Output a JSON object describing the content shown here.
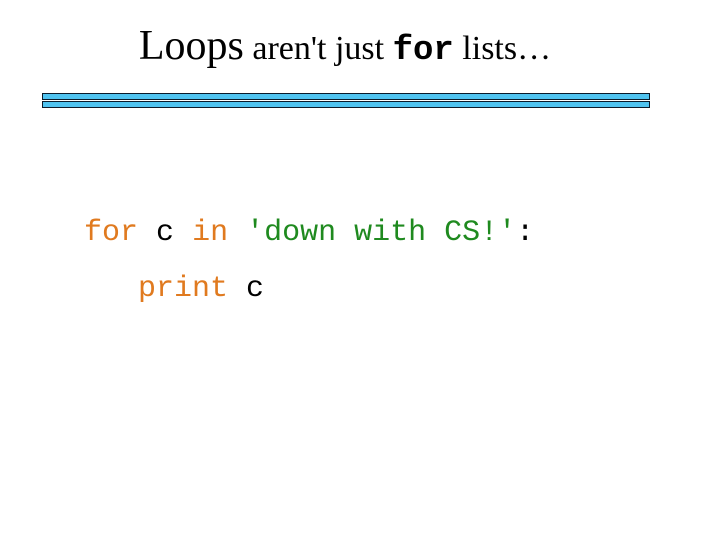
{
  "slide": {
    "title": {
      "part1": "Loops",
      "part2": " aren't just ",
      "code": "for",
      "part3": " lists…"
    },
    "code": {
      "line1": {
        "kw_for": "for",
        "sp1": " ",
        "var": "c",
        "sp2": " ",
        "kw_in": "in",
        "sp3": " ",
        "string": "'down with CS!'",
        "colon": ":"
      },
      "line2": {
        "indent": "   ",
        "kw_print": "print",
        "sp": " ",
        "var": "c"
      }
    },
    "colors": {
      "keyword": "#e07a1f",
      "string": "#1f8a1f",
      "rule": "#4fc3f0"
    }
  }
}
